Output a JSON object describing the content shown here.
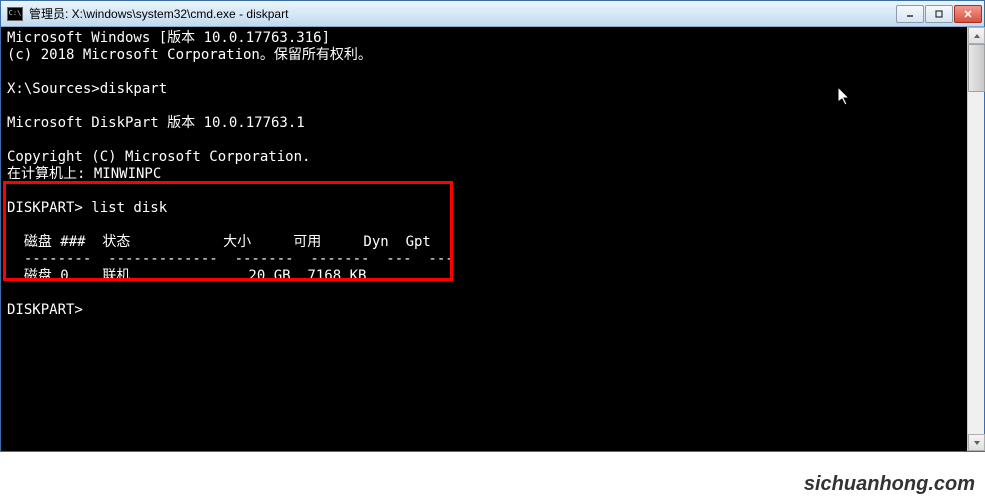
{
  "window": {
    "icon_label": "C:\\",
    "title": "管理员: X:\\windows\\system32\\cmd.exe - diskpart"
  },
  "terminal": {
    "lines": {
      "l1": "Microsoft Windows [版本 10.0.17763.316]",
      "l2": "(c) 2018 Microsoft Corporation。保留所有权利。",
      "l3": "",
      "l4": "X:\\Sources>diskpart",
      "l5": "",
      "l6": "Microsoft DiskPart 版本 10.0.17763.1",
      "l7": "",
      "l8": "Copyright (C) Microsoft Corporation.",
      "l9": "在计算机上: MINWINPC",
      "l10": "",
      "l11": "DISKPART> list disk",
      "l12": "",
      "l13": "  磁盘 ###  状态           大小     可用     Dyn  Gpt",
      "l14": "  --------  -------------  -------  -------  ---  ---",
      "l15": "  磁盘 0    联机              20 GB  7168 KB",
      "l16": "",
      "l17": "DISKPART>"
    }
  },
  "watermark": "sichuanhong.com"
}
